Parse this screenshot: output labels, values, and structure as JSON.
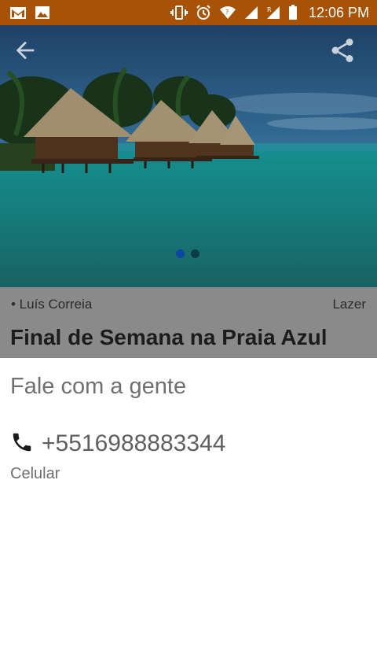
{
  "status_bar": {
    "time": "12:06 PM",
    "background": "#a75204",
    "icons_left": [
      "gmail-icon",
      "image-icon"
    ],
    "icons_right": [
      "vibrate-icon",
      "alarm-icon",
      "wifi-icon",
      "signal-icon",
      "signal-r-icon",
      "battery-icon"
    ]
  },
  "hero": {
    "back_icon": "arrow-left-icon",
    "share_icon": "share-icon",
    "pager": {
      "count": 2,
      "active": 1,
      "active_color": "#0d47a1"
    }
  },
  "post": {
    "author": "• Luís Correia",
    "category": "Lazer",
    "title": "Final de Semana na Praia Azul"
  },
  "contact_sheet": {
    "title": "Fale com a gente",
    "phone_icon": "phone-icon",
    "phone_number": "+5516988883344",
    "phone_type": "Celular"
  }
}
